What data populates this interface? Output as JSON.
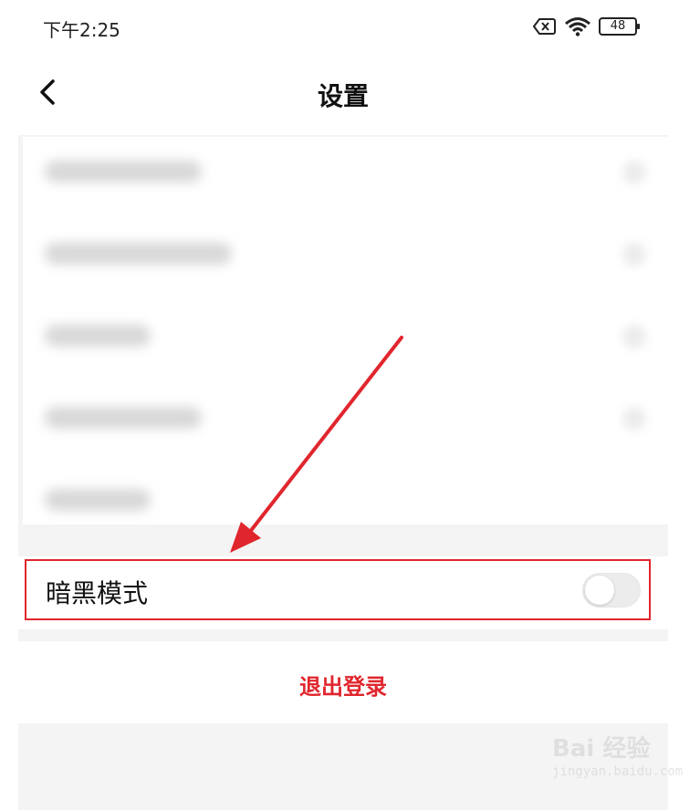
{
  "status_bar": {
    "time": "下午2:25",
    "battery": "48",
    "icons": [
      "sim-error-icon",
      "wifi-icon",
      "battery-icon"
    ]
  },
  "header": {
    "title": "设置",
    "back_icon": "chevron-left-icon"
  },
  "settings": {
    "dark_mode": {
      "label": "暗黑模式",
      "enabled": false
    },
    "logout_label": "退出登录"
  },
  "watermark": {
    "logo": "Bai 经验",
    "url": "jingyan.baidu.com"
  },
  "colors": {
    "accent": "#e0262d",
    "background": "#f4f4f4",
    "card": "#ffffff"
  }
}
